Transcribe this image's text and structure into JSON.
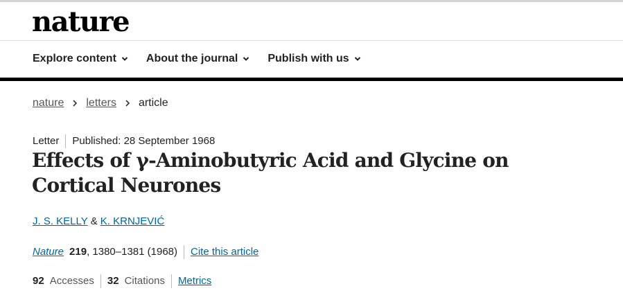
{
  "header": {
    "logo": "nature",
    "nav": [
      {
        "label": "Explore content"
      },
      {
        "label": "About the journal"
      },
      {
        "label": "Publish with us"
      }
    ]
  },
  "breadcrumb": {
    "items": [
      "nature",
      "letters"
    ],
    "current": "article"
  },
  "article": {
    "type": "Letter",
    "published": "Published: 28 September 1968",
    "title": "Effects of γ-Aminobutyric Acid and Glycine on Cortical Neurones",
    "authors": [
      "J. S. KELLY",
      "K. KRNJEVIĆ"
    ],
    "author_separator": "&",
    "citation": {
      "journal": "Nature",
      "volume": "219",
      "pages": ", 1380–1381 (1968)",
      "cite_label": "Cite this article"
    },
    "metrics": {
      "accesses_count": "92",
      "accesses_label": "Accesses",
      "citations_count": "32",
      "citations_label": "Citations",
      "metrics_link": "Metrics"
    }
  },
  "colors": {
    "link": "#006699",
    "text": "#222222",
    "bar": "#000000"
  }
}
